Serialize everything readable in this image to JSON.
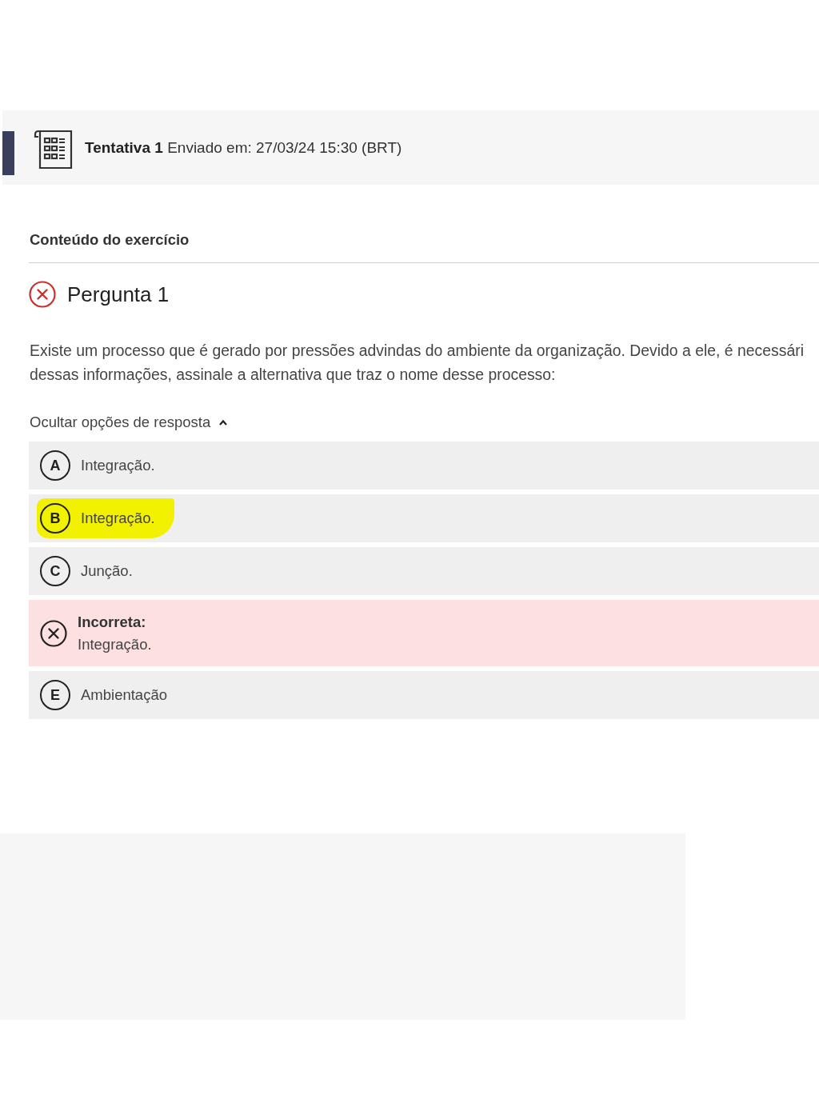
{
  "attempt": {
    "label": "Tentativa 1",
    "submitted": "Enviado em: 27/03/24 15:30 (BRT)"
  },
  "section_title": "Conteúdo do exercício",
  "question": {
    "title": "Pergunta 1",
    "correct": false,
    "lines": [
      "Existe um processo que é gerado por pressões advindas do ambiente da organização. Devido a ele, é necessári",
      "dessas informações, assinale a alternativa que traz o nome desse processo:"
    ]
  },
  "toggle": {
    "label": "Ocultar opções de resposta",
    "expanded": true
  },
  "options": [
    {
      "kind": "letter",
      "letter": "A",
      "text": "Integração.",
      "highlighted": false
    },
    {
      "kind": "letter",
      "letter": "B",
      "text": "Integração.",
      "highlighted": true
    },
    {
      "kind": "letter",
      "letter": "C",
      "text": "Junção.",
      "highlighted": false
    },
    {
      "kind": "incorrect",
      "label": "Incorreta:",
      "text": "Integração.",
      "highlighted": false
    },
    {
      "kind": "letter",
      "letter": "E",
      "text": "Ambientação",
      "highlighted": false
    }
  ]
}
